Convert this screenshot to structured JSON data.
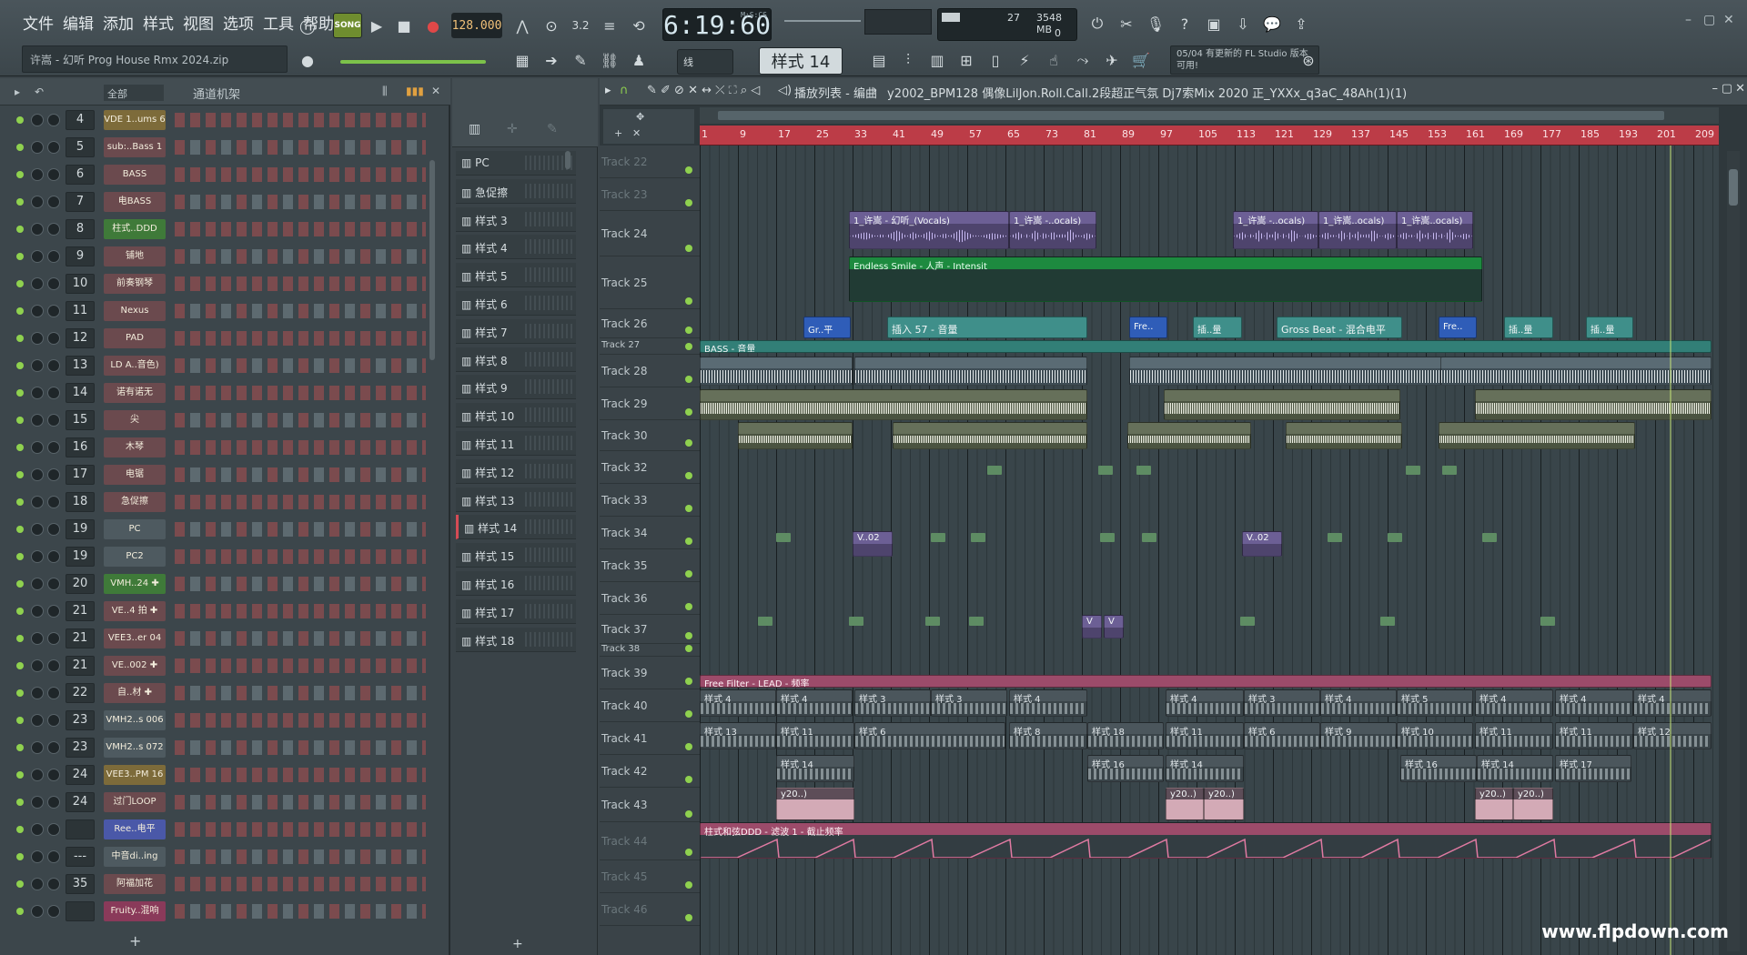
{
  "menus": [
    "文件",
    "编辑",
    "添加",
    "样式",
    "视图",
    "选项",
    "工具",
    "帮助"
  ],
  "project_file": "许嵩 - 幻听 Prog House Rmx 2024.zip",
  "transport": {
    "song_label": "SONG",
    "tempo": "128.000",
    "time": "6:19:60",
    "time_unit": "M:S:CS"
  },
  "cpu": {
    "voices": "27",
    "memory": "3548 MB",
    "zero": "0"
  },
  "pattern_label": "样式 14",
  "snap_label": "线",
  "news": {
    "date": "05/04",
    "text": "有更新的 FL Studio 版本可用!"
  },
  "rack": {
    "filter": "全部",
    "title": "通道机架",
    "channels": [
      {
        "num": "4",
        "name": "VDE 1..ums 6",
        "color": "#7d6b3a"
      },
      {
        "num": "5",
        "name": "sub:..Bass 1",
        "color": "#6b4a4e"
      },
      {
        "num": "6",
        "name": "BASS",
        "color": "#6b4a4e"
      },
      {
        "num": "7",
        "name": "电BASS",
        "color": "#6b4a4e"
      },
      {
        "num": "8",
        "name": "柱式..DDD",
        "color": "#3f7a39"
      },
      {
        "num": "9",
        "name": "铺地",
        "color": "#6b4a4e"
      },
      {
        "num": "10",
        "name": "前奏钢琴",
        "color": "#6b4a4e"
      },
      {
        "num": "11",
        "name": "Nexus",
        "color": "#6b4a4e"
      },
      {
        "num": "12",
        "name": "PAD",
        "color": "#6b4a4e"
      },
      {
        "num": "13",
        "name": "LD A..音色)",
        "color": "#6b4a4e"
      },
      {
        "num": "14",
        "name": "诺有诺无",
        "color": "#6b4a4e"
      },
      {
        "num": "15",
        "name": "尖",
        "color": "#6b4a4e"
      },
      {
        "num": "16",
        "name": "木琴",
        "color": "#6b4a4e"
      },
      {
        "num": "17",
        "name": "电锯",
        "color": "#6b4a4e"
      },
      {
        "num": "18",
        "name": "急促擦",
        "color": "#6b4a4e"
      },
      {
        "num": "19",
        "name": "PC",
        "color": "#4e5a60"
      },
      {
        "num": "19",
        "name": "PC2",
        "color": "#4e5a60"
      },
      {
        "num": "20",
        "name": "VMH..24 ✚",
        "color": "#3f7a39"
      },
      {
        "num": "21",
        "name": "VE..4 拍 ✚",
        "color": "#6b4a4e"
      },
      {
        "num": "21",
        "name": "VEE3..er 04",
        "color": "#6b4a4e"
      },
      {
        "num": "21",
        "name": "VE..002 ✚",
        "color": "#6b4a4e"
      },
      {
        "num": "22",
        "name": "自..材 ✚",
        "color": "#6b4a4e"
      },
      {
        "num": "23",
        "name": "VMH2..s 006",
        "color": "#4e5a60"
      },
      {
        "num": "23",
        "name": "VMH2..s 072",
        "color": "#4e5a60"
      },
      {
        "num": "24",
        "name": "VEE3..PM 16",
        "color": "#7d6b3a"
      },
      {
        "num": "24",
        "name": "过门LOOP",
        "color": "#6b4a4e"
      },
      {
        "num": "",
        "name": "Ree..电平",
        "color": "#4a58a8"
      },
      {
        "num": "---",
        "name": "中音di..ing",
        "color": "#4e5a60"
      },
      {
        "num": "35",
        "name": "阿福加花",
        "color": "#6b4a4e"
      },
      {
        "num": "",
        "name": "Fruity..混响",
        "color": "#8a3a5a"
      }
    ]
  },
  "picker": {
    "items": [
      "PC",
      "急促擦",
      "样式 3",
      "样式 4",
      "样式 5",
      "样式 6",
      "样式 7",
      "样式 8",
      "样式 9",
      "样式 10",
      "样式 11",
      "样式 12",
      "样式 13",
      "样式 14",
      "样式 15",
      "样式 16",
      "样式 17",
      "样式 18"
    ]
  },
  "playlist": {
    "title": "播放列表 - 编曲",
    "song": "y2002_BPM128 偶像LilJon.Roll.Call.2段超正气氛 Dj7索Mix 2020 正_YXXx_q3aC_48Ah(1)(1)",
    "bars": [
      "1",
      "9",
      "17",
      "25",
      "33",
      "41",
      "49",
      "57",
      "65",
      "73",
      "81",
      "89",
      "97",
      "105",
      "113",
      "121",
      "129",
      "137",
      "145",
      "153",
      "161",
      "169",
      "177",
      "185",
      "193",
      "201",
      "209"
    ],
    "tracks": [
      "Track 22",
      "Track 23",
      "Track 24",
      "Track 25",
      "Track 26",
      "Track 27",
      "Track 28",
      "Track 29",
      "Track 30",
      "Track 32",
      "Track 33",
      "Track 34",
      "Track 35",
      "Track 36",
      "Track 37",
      "Track 38",
      "Track 39",
      "Track 40",
      "Track 41",
      "Track 42",
      "Track 43",
      "Track 44",
      "Track 45",
      "Track 46"
    ],
    "clips": {
      "voc1": "1_许嵩 - 幻听_(Vocals)",
      "voc2": "1_许嵩 -..ocals)",
      "voc3": "1_许嵩 -..ocals)",
      "voc4": "1_许嵩..ocals)",
      "voc5": "1_许嵩..ocals)",
      "endless": "Endless Smile - 人声 - Intensit",
      "gr": "Gr..平",
      "ins57": "插入 57 - 音量",
      "fre1": "Fre..",
      "ins1": "插..量",
      "gross": "Gross Beat - 混合电平",
      "fre2": "Fre..",
      "ins2": "插..量",
      "ins3": "插..量",
      "bass": "BASS - 音量",
      "v02a": "V..02",
      "v02b": "V..02",
      "v1": "V",
      "v2": "V",
      "filter": "Free Filter - LEAD - 频率",
      "pat4a": "样式 4",
      "pat4b": "样式 4",
      "pat3a": "样式 3",
      "pat3b": "样式 3",
      "pat4c": "样式 4",
      "pat4d": "样式 4",
      "pat3c": "样式 3",
      "pat4e": "样式 4",
      "pat5": "样式 5",
      "pat4f": "样式 4",
      "pat4g": "样式 4",
      "pat4h": "样式 4",
      "pat13": "样式 13",
      "pat11a": "样式 11",
      "pat6a": "样式 6",
      "pat8": "样式 8",
      "pat18": "样式 18",
      "pat11b": "样式 11",
      "pat6b": "样式 6",
      "pat9": "样式 9",
      "pat10": "样式 10",
      "pat11c": "样式 11",
      "pat11d": "样式 11",
      "pat12": "样式 12",
      "pat14a": "样式 14",
      "pat16a": "样式 16",
      "pat14b": "样式 14",
      "pat16b": "样式 16",
      "pat14c": "样式 14",
      "pat17": "样式 17",
      "y1": "y20..)",
      "y2": "y20..)",
      "y3": "y20..)",
      "y4": "y20..)",
      "y5": "y20..)",
      "y6": "y20..)",
      "filt2": "柱式和弦DDD - 滤波 1 - 截止频率"
    }
  },
  "watermark": "www.flpdown.com"
}
